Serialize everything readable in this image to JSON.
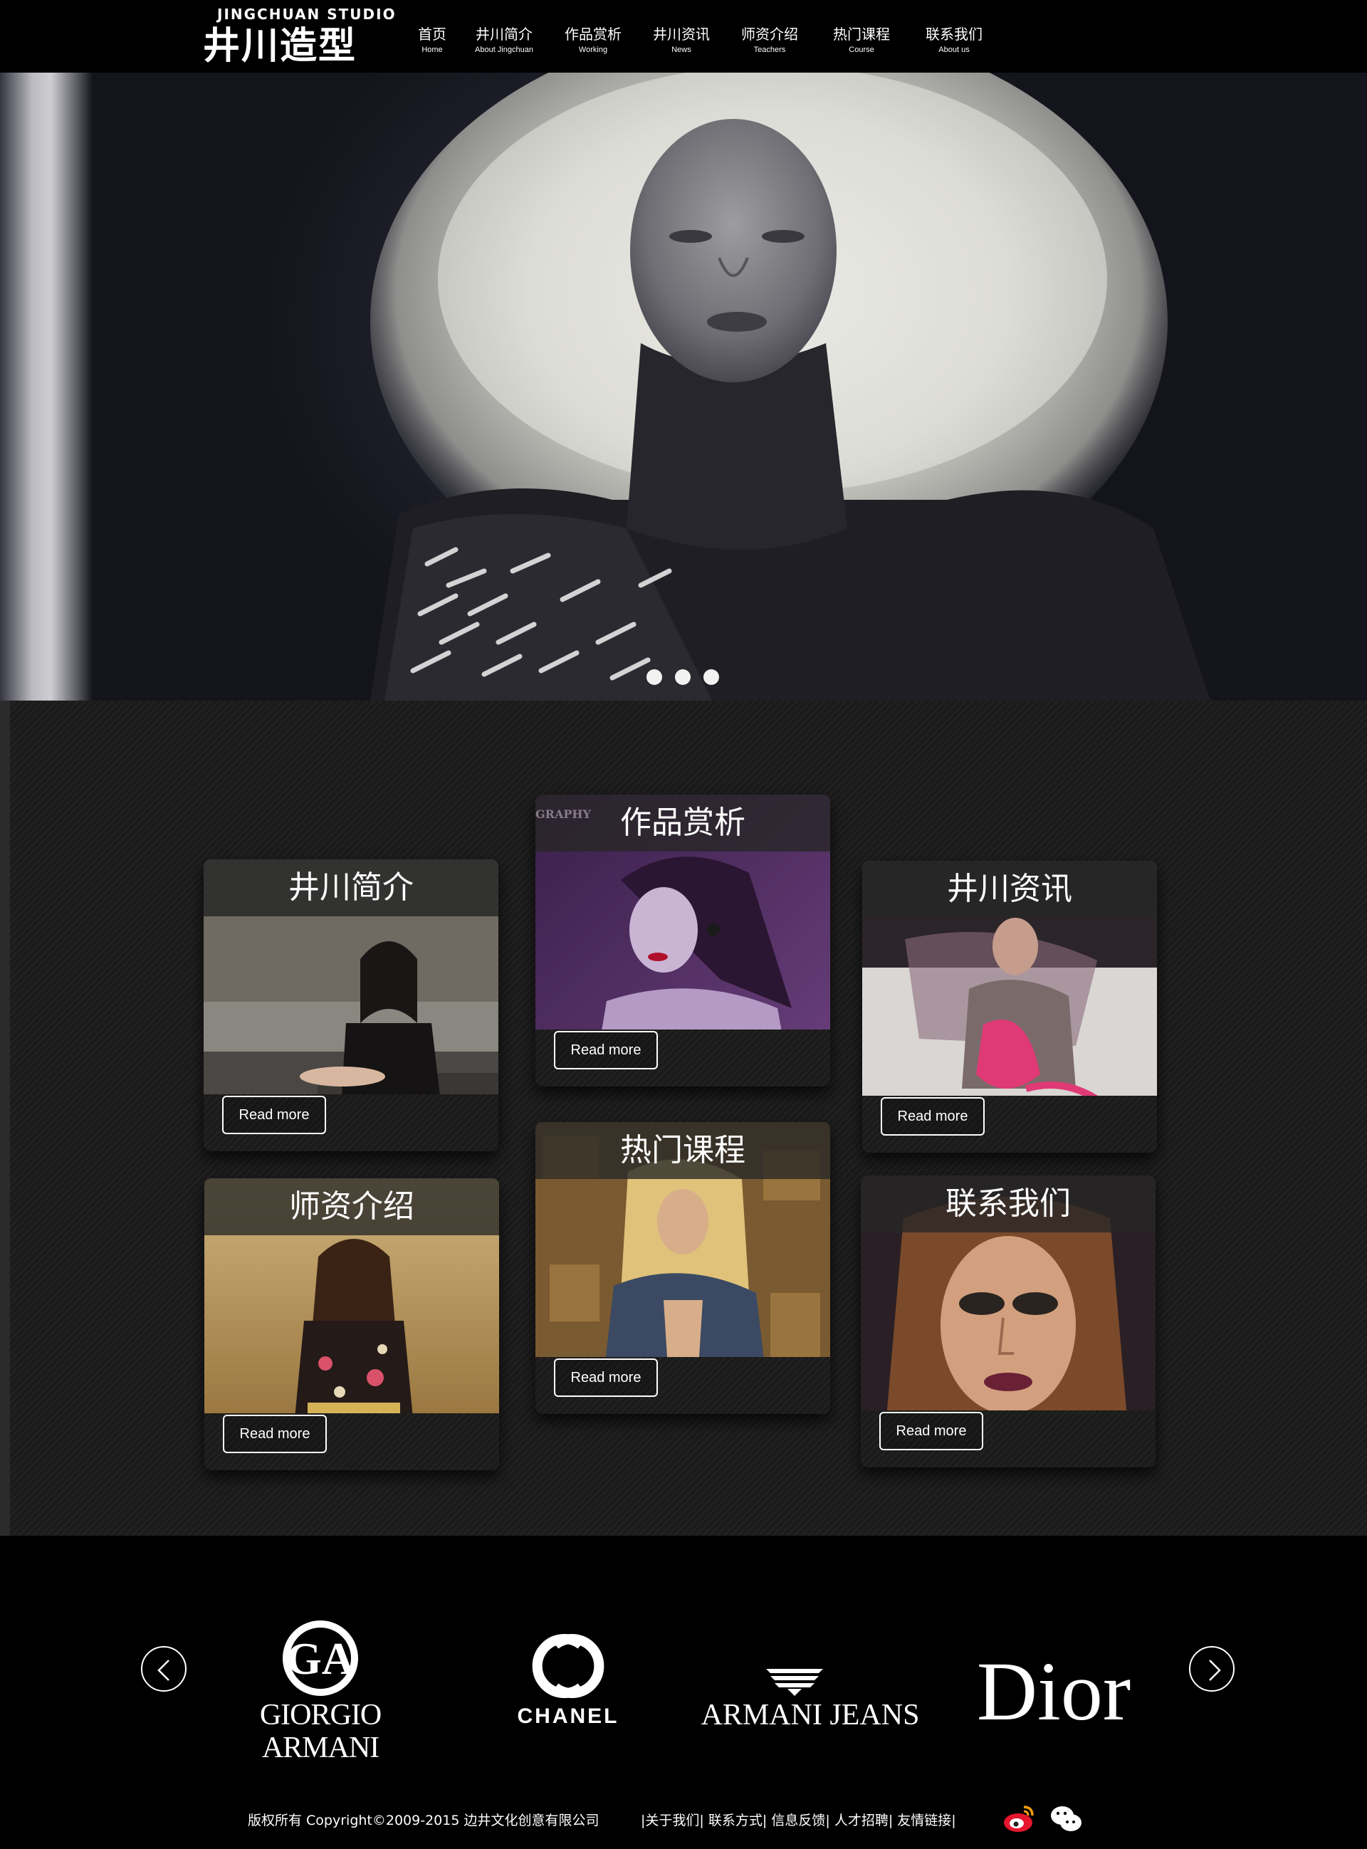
{
  "header": {
    "logo_en": "JINGCHUAN STUDIO",
    "logo_cn": "井川造型",
    "nav": [
      {
        "cn": "首页",
        "en": "Home"
      },
      {
        "cn": "井川简介",
        "en": "About Jingchuan"
      },
      {
        "cn": "作品赏析",
        "en": "Working"
      },
      {
        "cn": "井川资讯",
        "en": "News"
      },
      {
        "cn": "师资介绍",
        "en": "Teachers"
      },
      {
        "cn": "热门课程",
        "en": "Course"
      },
      {
        "cn": "联系我们",
        "en": "About us"
      }
    ]
  },
  "hero": {
    "slides_count": 3
  },
  "cards": [
    {
      "title": "井川简介",
      "button": "Read more"
    },
    {
      "title": "作品赏析",
      "button": "Read more",
      "overlay_text": "GRAPHY"
    },
    {
      "title": "井川资讯",
      "button": "Read more"
    },
    {
      "title": "师资介绍",
      "button": "Read more"
    },
    {
      "title": "热门课程",
      "button": "Read more"
    },
    {
      "title": "联系我们",
      "button": "Read more"
    }
  ],
  "brands": {
    "items": [
      {
        "name": "GIORGIO ARMANI",
        "logo": "GA"
      },
      {
        "name": "CHANEL",
        "logo": "CC"
      },
      {
        "name": "ARMANI JEANS",
        "logo": "eagle"
      },
      {
        "name": "Dior",
        "logo": ""
      }
    ]
  },
  "footer": {
    "copyright": "版权所有 Copyright©2009-2015 边井文化创意有限公司",
    "links": [
      "关于我们",
      "联系方式",
      "信息反馈",
      "人才招聘",
      "友情链接"
    ],
    "social": [
      "weibo-icon",
      "wechat-icon"
    ]
  }
}
